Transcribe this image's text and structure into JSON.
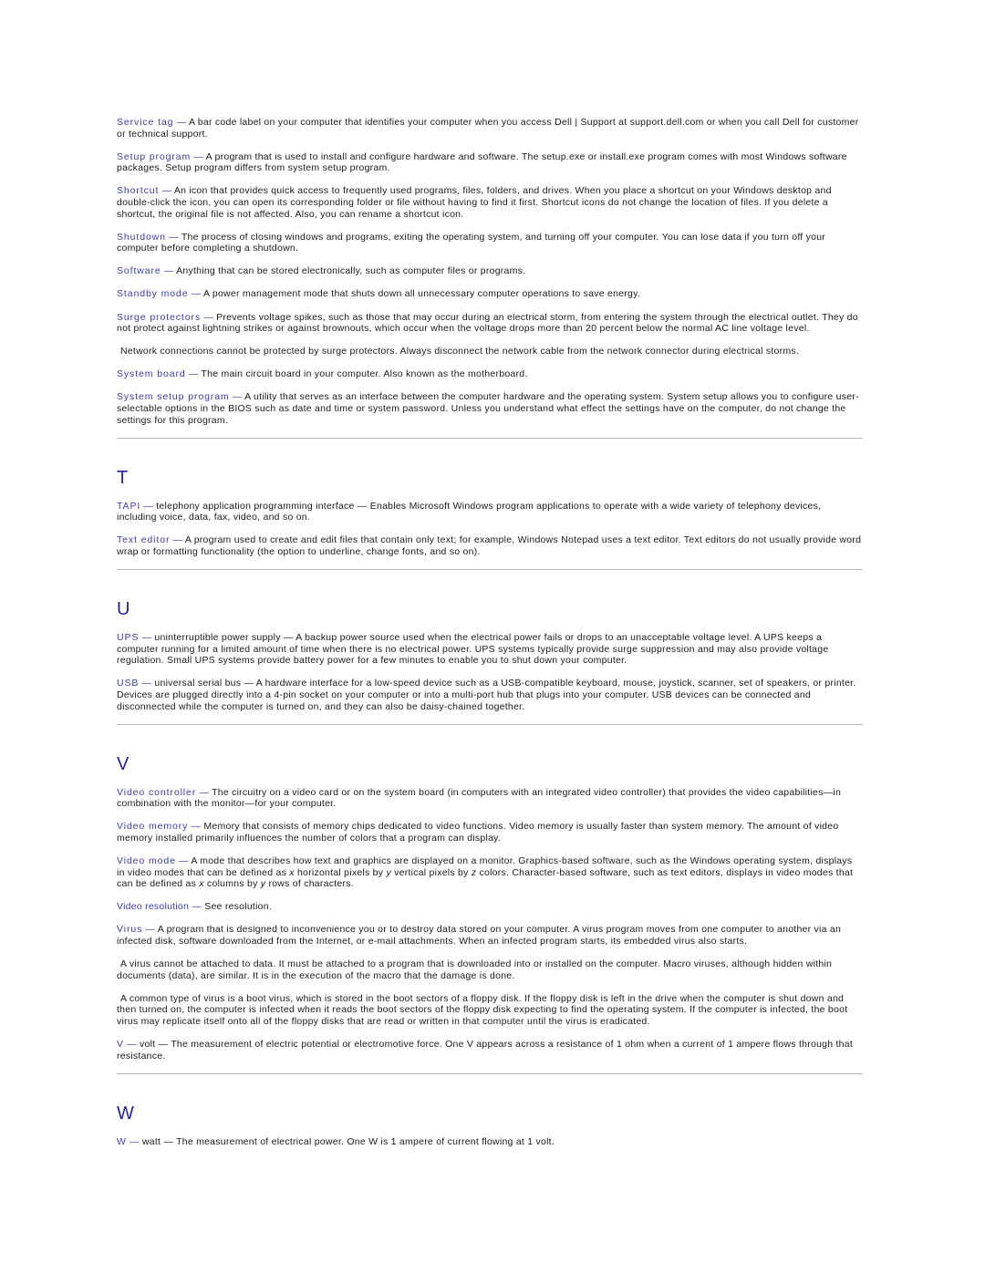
{
  "document": {
    "type": "glossary",
    "accent_color": "#3a3ab0",
    "heading_color": "#2222a0",
    "rule_color": "#b9b9b9",
    "body_color": "#1a1a1a"
  },
  "entries_s": [
    {
      "term": "Service tag",
      "dash": " — ",
      "definition": "A bar code label on your computer that identifies your computer when you access Dell | Support at support.dell.com or when you call Dell for customer or technical support."
    },
    {
      "term": "Setup program",
      "dash": " — ",
      "definition": "A program that is used to install and configure hardware and software. The setup.exe or install.exe program comes with most Windows software packages. Setup program differs from system setup program."
    },
    {
      "term": "Shortcut",
      "dash": " — ",
      "definition": "An icon that provides quick access to frequently used programs, files, folders, and drives. When you place a shortcut on your Windows desktop and double-click the icon, you can open its corresponding folder or file without having to find it first. Shortcut icons do not change the location of files. If you delete a shortcut, the original file is not affected. Also, you can rename a shortcut icon."
    },
    {
      "term": "Shutdown",
      "dash": " — ",
      "definition": "The process of closing windows and programs, exiting the operating system, and turning off your computer. You can lose data if you turn off your computer before completing a shutdown."
    },
    {
      "term": "Software",
      "dash": " — ",
      "definition": "Anything that can be stored electronically, such as computer files or programs."
    },
    {
      "term": "Standby mode",
      "dash": " — ",
      "definition": "A power management mode that shuts down all unnecessary computer operations to save energy."
    },
    {
      "term": "Surge protectors",
      "dash": " — ",
      "definition": "Prevents voltage spikes, such as those that may occur during an electrical storm, from entering the system through the electrical outlet. They do not protect against lightning strikes or against brownouts, which occur when the voltage drops more than 20 percent below the normal AC line voltage level."
    }
  ],
  "paragraph_surge_note": " Network connections cannot be protected by surge protectors. Always disconnect the network cable from the network connector during electrical storms.",
  "entries_s2": [
    {
      "term": "System board",
      "dash": " — ",
      "definition": "The main circuit board in your computer. Also known as the motherboard."
    },
    {
      "term": "System setup program",
      "dash": " — ",
      "definition": "A utility that serves as an interface between the computer hardware and the operating system. System setup allows you to configure user-selectable options in the BIOS such as date and time or system password. Unless you understand what effect the settings have on the computer, do not change the settings for this program."
    }
  ],
  "section_t": {
    "letter": "T",
    "entries": [
      {
        "term": "TAPI",
        "dash": " — ",
        "expansion": "telephony application programming interface",
        "dash2": " — ",
        "definition": "Enables Microsoft Windows program applications to operate with a wide variety of telephony devices, including voice, data, fax, video, and so on."
      },
      {
        "term": "Text editor",
        "dash": " — ",
        "definition": "A program used to create and edit files that contain only text; for example, Windows Notepad uses a text editor. Text editors do not usually provide word wrap or formatting functionality (the option to underline, change fonts, and so on)."
      }
    ]
  },
  "section_u": {
    "letter": "U",
    "entries": [
      {
        "term": "UPS",
        "dash": " — ",
        "expansion": "uninterruptible power supply",
        "dash2": " — ",
        "definition": "A backup power source used when the electrical power fails or drops to an unacceptable voltage level. A UPS keeps a computer running for a limited amount of time when there is no electrical power. UPS systems typically provide surge suppression and may also provide voltage regulation. Small UPS systems provide battery power for a few minutes to enable you to shut down your computer."
      },
      {
        "term": "USB",
        "dash": " — ",
        "expansion": "universal serial bus",
        "dash2": " — ",
        "definition": "A hardware interface for a low-speed device such as a USB-compatible keyboard, mouse, joystick, scanner, set of speakers, or printer. Devices are plugged directly into a 4-pin socket on your computer or into a multi-port hub that plugs into your computer. USB devices can be connected and disconnected while the computer is turned on, and they can also be daisy-chained together."
      }
    ]
  },
  "section_v": {
    "letter": "V",
    "video_controller": {
      "term": "Video controller",
      "dash": " — ",
      "definition": "The circuitry on a video card or on the system board (in computers with an integrated video controller) that provides the video capabilities—in combination with the monitor—for your computer."
    },
    "video_memory": {
      "term": "Video memory",
      "dash": " — ",
      "definition": "Memory that consists of memory chips dedicated to video functions. Video memory is usually faster than system memory. The amount of video memory installed primarily influences the number of colors that a program can display."
    },
    "video_mode": {
      "term": "Video mode",
      "dash": " — ",
      "part1": "A mode that describes how text and graphics are displayed on a monitor. Graphics-based software, such as the Windows operating system, displays in video modes that can be defined as ",
      "var_x1": "x",
      "part2": " horizontal pixels by ",
      "var_y1": "y",
      "part3": " vertical pixels by ",
      "var_z": "z",
      "part4": " colors. Character-based software, such as text editors, displays in video modes that can be defined as ",
      "var_x2": "x",
      "part5": " columns by ",
      "var_y2": "y",
      "part6": " rows of characters."
    },
    "video_resolution": {
      "term": "Video resolution",
      "dash": " — ",
      "definition": "See resolution."
    },
    "virus": {
      "term": "Virus",
      "dash": " — ",
      "definition": "A program that is designed to inconvenience you or to destroy data stored on your computer. A virus program moves from one computer to another via an infected disk, software downloaded from the Internet, or e-mail attachments. When an infected program starts, its embedded virus also starts."
    },
    "virus_para_2": " A virus cannot be attached to data. It must be attached to a program that is downloaded into or installed on the computer. Macro viruses, although hidden within documents (data), are similar. It is in the execution of the macro that the damage is done.",
    "virus_para_3": " A common type of virus is a boot virus, which is stored in the boot sectors of a floppy disk. If the floppy disk is left in the drive when the computer is shut down and then turned on, the computer is infected when it reads the boot sectors of the floppy disk expecting to find the operating system. If the computer is infected, the boot virus may replicate itself onto all of the floppy disks that are read or written in that computer until the virus is eradicated.",
    "volt": {
      "term": "V",
      "dash": " — ",
      "expansion": "volt",
      "dash2": " — ",
      "definition": "The measurement of electric potential or electromotive force. One V appears across a resistance of 1 ohm when a current of 1 ampere flows through that resistance."
    }
  },
  "section_w": {
    "letter": "W",
    "watt": {
      "term": "W",
      "dash": " — ",
      "expansion": "watt",
      "dash2": " — ",
      "definition": "The measurement of electrical power. One W is 1 ampere of current flowing at 1 volt."
    }
  }
}
